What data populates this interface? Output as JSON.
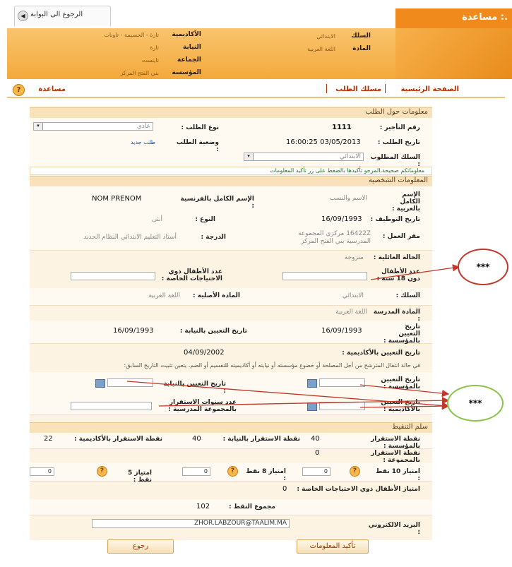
{
  "header": {
    "portal_back": "الرجوع الى البوابة",
    "brand": "مساعدة :.",
    "fields": [
      {
        "label": "الأكاديمية",
        "value": "تازة - الحسيمة - تاونات"
      },
      {
        "label": "النيابة",
        "value": "تازة"
      },
      {
        "label": "الجماعة",
        "value": "تاينست"
      },
      {
        "label": "المؤسسة",
        "value": "بني الفتح المركز"
      },
      {
        "label": "السلك",
        "value": "الابتدائي"
      },
      {
        "label": "المادة",
        "value": "اللغة العربية"
      }
    ]
  },
  "nav": {
    "home": "الصفحة الرئيسية",
    "request_path": "مسلك الطلب",
    "help": "مساعدة"
  },
  "request": {
    "title": "معلومات حول الطلب",
    "request_type_label": "نوع الطلب :",
    "request_type_value": "عادي",
    "order_number_label": "رقم التأجير :",
    "order_number_value": "1111",
    "request_date_label": "تاريخ الطلب :",
    "request_date_value": "16:00:25 03/05/2013",
    "request_status_label": "وضعية الطلب :",
    "request_status_value": "طلب جديد",
    "required_cycle_label": "السلك المطلوب :",
    "required_cycle_value": "الابتدائي",
    "confirm_msg": "معلوماتكم صحيحة،المرجو تأكيدها بالضغط على زر تأكيد المعلومات"
  },
  "personal": {
    "title": "المعلومات الشخصية",
    "fullname_ar_label": "الإسم الكامل بالعربية :",
    "fullname_ar_value": "الاسم والنسب",
    "fullname_fr_label": "الإسم الكامل بالفرنسية :",
    "fullname_fr_value": "NOM PRENOM",
    "hire_date_label": "تاريخ التوظيف :",
    "hire_date_value": "16/09/1993",
    "gender_label": "النوع :",
    "gender_value": "أنثى",
    "workplace_label": "مقر العمل :",
    "workplace_value": "16422Z مركزي المجموعة المدرسية بني الفتح المركز",
    "grade_label": "الدرجة :",
    "grade_value": "أستاذ التعليم الابتدائي النظام الجديد",
    "marital_label": "الحالة العائلية :",
    "marital_value": "متزوجة",
    "children_label": "عدد الأطفال دون 18 سنة :",
    "special_children_label": "عدد الأطفال ذوي الاحتياجات الخاصة :",
    "cycle_label": "السلك :",
    "cycle_value": "الابتدائي",
    "original_subject_label": "المادة الأصلية :",
    "original_subject_value": "اللغة العربية",
    "taught_subject_label": "المادة المدرسة :",
    "taught_subject_value": "اللغة العربية",
    "appoint_school_label": "تاريخ التعيين بالمؤسسة :",
    "appoint_school_value": "16/09/1993",
    "appoint_province_label": "تاريخ التعيين بالنيابة :",
    "appoint_province_value": "16/09/1993",
    "appoint_academy_label": "تاريخ التعيين بالأكاديمية :",
    "appoint_academy_value": "04/09/2002",
    "transfer_note": "في حالة انتقال المترشح من أجل المصلحة أو خضوع مؤسسته أو نيابته أو أكاديميته للتقسيم أو الضم، يتعين تثبيت التاريخ السابق:",
    "prev_school_label": "تاريخ التعيين بالمؤسسة :",
    "prev_province_label": "تاريخ التعيين بالنيابة :",
    "prev_academy_label": "تاريخ التعيين بالأكاديمية :",
    "stability_years_label": "عدد سنوات الاستقرار بالمجموعة المدرسية :"
  },
  "points": {
    "title": "سلم التنقيط",
    "school_label": "نقطة الاستقرار بالمؤسسة :",
    "school_value": "40",
    "province_label": "نقطة الاستقرار بالنيابة :",
    "province_value": "40",
    "academy_label": "نقطة الاستقرار بالأكاديمية :",
    "academy_value": "22",
    "group_label": "نقطة الاستقرار بالمجموعة :",
    "group_value": "0",
    "priv10_label": "امتياز 10 نقط :",
    "priv10_value": "0",
    "priv8_label": "امتياز 8 نقط :",
    "priv8_value": "0",
    "priv5_label": "امتياز 5 نقط :",
    "priv5_value": "0",
    "special_priv_label": "امتياز الأطفال ذوي الاحتياجات الخاصة :",
    "special_priv_value": "0",
    "total_label": "مجموع النقط :",
    "total_value": "102",
    "email_label": "البريد الالكتروني :",
    "email_value": "ZHOR.LABZOUR@TAALIM.MA"
  },
  "buttons": {
    "back": "رجوع",
    "confirm": "تأكيد المعلومات"
  },
  "annotations": {
    "a1": "***",
    "a2": "***",
    "color_red": "#c0392b",
    "color_green": "#8bc34a"
  }
}
